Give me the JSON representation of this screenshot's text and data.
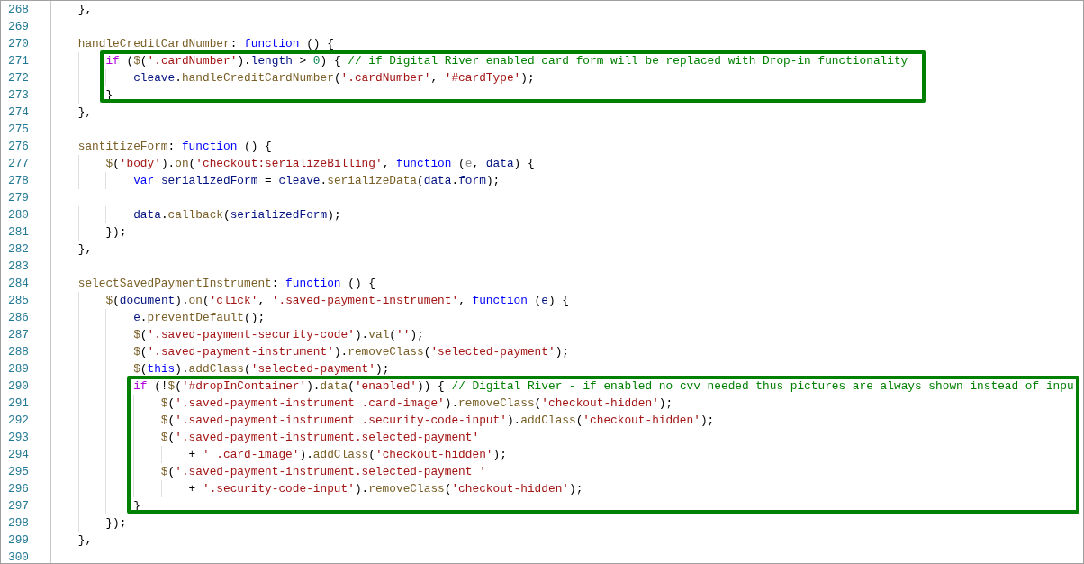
{
  "code": [
    {
      "kind": "line",
      "number": "268",
      "tokens": [
        {
          "text": "    },",
          "kind": "plain"
        }
      ]
    },
    {
      "kind": "line",
      "number": "269"
    },
    {
      "kind": "line",
      "number": "270",
      "tokens": [
        {
          "text": "    handleCreditCardNumber",
          "kind": "function"
        },
        {
          "text": ": ",
          "kind": "plain"
        },
        {
          "text": "function",
          "kind": "keyword"
        },
        {
          "text": " () {",
          "kind": "plain"
        }
      ]
    },
    {
      "kind": "highlight",
      "lines": [
        {
          "kind": "line",
          "number": "271",
          "tokens": [
            {
              "text": "        if",
              "kind": "control"
            },
            {
              "text": " (",
              "kind": "plain"
            },
            {
              "text": "$",
              "kind": "function"
            },
            {
              "text": "(",
              "kind": "plain"
            },
            {
              "text": "'.cardNumber'",
              "kind": "string"
            },
            {
              "text": ").",
              "kind": "plain"
            },
            {
              "text": "length",
              "kind": "variable"
            },
            {
              "text": " > ",
              "kind": "plain"
            },
            {
              "text": "0",
              "kind": "number"
            },
            {
              "text": ") { ",
              "kind": "plain"
            },
            {
              "text": "// if Digital River enabled card form will be replaced with Drop-in functionality",
              "kind": "comment"
            }
          ]
        },
        {
          "kind": "line",
          "number": "272",
          "tokens": [
            {
              "text": "            cleave",
              "kind": "variable"
            },
            {
              "text": ".",
              "kind": "plain"
            },
            {
              "text": "handleCreditCardNumber",
              "kind": "function"
            },
            {
              "text": "(",
              "kind": "plain"
            },
            {
              "text": "'.cardNumber'",
              "kind": "string"
            },
            {
              "text": ", ",
              "kind": "plain"
            },
            {
              "text": "'#cardType'",
              "kind": "string"
            },
            {
              "text": ");",
              "kind": "plain"
            }
          ]
        },
        {
          "kind": "line",
          "number": "273",
          "tokens": [
            {
              "text": "        }",
              "kind": "plain"
            }
          ]
        }
      ]
    },
    {
      "kind": "line",
      "number": "274",
      "tokens": [
        {
          "text": "    },",
          "kind": "plain"
        }
      ]
    },
    {
      "kind": "line",
      "number": "275"
    },
    {
      "kind": "line",
      "number": "276",
      "tokens": [
        {
          "text": "    santitizeForm",
          "kind": "function"
        },
        {
          "text": ": ",
          "kind": "plain"
        },
        {
          "text": "function",
          "kind": "keyword"
        },
        {
          "text": " () {",
          "kind": "plain"
        }
      ]
    },
    {
      "kind": "line",
      "number": "277",
      "tokens": [
        {
          "text": "        $",
          "kind": "function"
        },
        {
          "text": "(",
          "kind": "plain"
        },
        {
          "text": "'body'",
          "kind": "string"
        },
        {
          "text": ").",
          "kind": "plain"
        },
        {
          "text": "on",
          "kind": "function"
        },
        {
          "text": "(",
          "kind": "plain"
        },
        {
          "text": "'checkout:serializeBilling'",
          "kind": "string"
        },
        {
          "text": ", ",
          "kind": "plain"
        },
        {
          "text": "function",
          "kind": "keyword"
        },
        {
          "text": " (",
          "kind": "plain"
        },
        {
          "text": "e",
          "kind": "unused"
        },
        {
          "text": ", ",
          "kind": "plain"
        },
        {
          "text": "data",
          "kind": "variable"
        },
        {
          "text": ") {",
          "kind": "plain"
        }
      ]
    },
    {
      "kind": "line",
      "number": "278",
      "tokens": [
        {
          "text": "            var",
          "kind": "keyword"
        },
        {
          "text": " serializedForm",
          "kind": "variable"
        },
        {
          "text": " = ",
          "kind": "plain"
        },
        {
          "text": "cleave",
          "kind": "variable"
        },
        {
          "text": ".",
          "kind": "plain"
        },
        {
          "text": "serializeData",
          "kind": "function"
        },
        {
          "text": "(",
          "kind": "plain"
        },
        {
          "text": "data",
          "kind": "variable"
        },
        {
          "text": ".",
          "kind": "plain"
        },
        {
          "text": "form",
          "kind": "variable"
        },
        {
          "text": ");",
          "kind": "plain"
        }
      ]
    },
    {
      "kind": "line",
      "number": "279"
    },
    {
      "kind": "line",
      "number": "280",
      "tokens": [
        {
          "text": "            data",
          "kind": "variable"
        },
        {
          "text": ".",
          "kind": "plain"
        },
        {
          "text": "callback",
          "kind": "function"
        },
        {
          "text": "(",
          "kind": "plain"
        },
        {
          "text": "serializedForm",
          "kind": "variable"
        },
        {
          "text": ");",
          "kind": "plain"
        }
      ]
    },
    {
      "kind": "line",
      "number": "281",
      "tokens": [
        {
          "text": "        });",
          "kind": "plain"
        }
      ]
    },
    {
      "kind": "line",
      "number": "282",
      "tokens": [
        {
          "text": "    },",
          "kind": "plain"
        }
      ]
    },
    {
      "kind": "line",
      "number": "283"
    },
    {
      "kind": "line",
      "number": "284",
      "tokens": [
        {
          "text": "    selectSavedPaymentInstrument",
          "kind": "function"
        },
        {
          "text": ": ",
          "kind": "plain"
        },
        {
          "text": "function",
          "kind": "keyword"
        },
        {
          "text": " () {",
          "kind": "plain"
        }
      ]
    },
    {
      "kind": "line",
      "number": "285",
      "tokens": [
        {
          "text": "        $",
          "kind": "function"
        },
        {
          "text": "(",
          "kind": "plain"
        },
        {
          "text": "document",
          "kind": "variable"
        },
        {
          "text": ").",
          "kind": "plain"
        },
        {
          "text": "on",
          "kind": "function"
        },
        {
          "text": "(",
          "kind": "plain"
        },
        {
          "text": "'click'",
          "kind": "string"
        },
        {
          "text": ", ",
          "kind": "plain"
        },
        {
          "text": "'.saved-payment-instrument'",
          "kind": "string"
        },
        {
          "text": ", ",
          "kind": "plain"
        },
        {
          "text": "function",
          "kind": "keyword"
        },
        {
          "text": " (",
          "kind": "plain"
        },
        {
          "text": "e",
          "kind": "variable"
        },
        {
          "text": ") {",
          "kind": "plain"
        }
      ]
    },
    {
      "kind": "line",
      "number": "286",
      "tokens": [
        {
          "text": "            e",
          "kind": "variable"
        },
        {
          "text": ".",
          "kind": "plain"
        },
        {
          "text": "preventDefault",
          "kind": "function"
        },
        {
          "text": "();",
          "kind": "plain"
        }
      ]
    },
    {
      "kind": "line",
      "number": "287",
      "tokens": [
        {
          "text": "            $",
          "kind": "function"
        },
        {
          "text": "(",
          "kind": "plain"
        },
        {
          "text": "'.saved-payment-security-code'",
          "kind": "string"
        },
        {
          "text": ").",
          "kind": "plain"
        },
        {
          "text": "val",
          "kind": "function"
        },
        {
          "text": "(",
          "kind": "plain"
        },
        {
          "text": "''",
          "kind": "string"
        },
        {
          "text": ");",
          "kind": "plain"
        }
      ]
    },
    {
      "kind": "line",
      "number": "288",
      "tokens": [
        {
          "text": "            $",
          "kind": "function"
        },
        {
          "text": "(",
          "kind": "plain"
        },
        {
          "text": "'.saved-payment-instrument'",
          "kind": "string"
        },
        {
          "text": ").",
          "kind": "plain"
        },
        {
          "text": "removeClass",
          "kind": "function"
        },
        {
          "text": "(",
          "kind": "plain"
        },
        {
          "text": "'selected-payment'",
          "kind": "string"
        },
        {
          "text": ");",
          "kind": "plain"
        }
      ]
    },
    {
      "kind": "line",
      "number": "289",
      "tokens": [
        {
          "text": "            $",
          "kind": "function"
        },
        {
          "text": "(",
          "kind": "plain"
        },
        {
          "text": "this",
          "kind": "keyword"
        },
        {
          "text": ").",
          "kind": "plain"
        },
        {
          "text": "addClass",
          "kind": "function"
        },
        {
          "text": "(",
          "kind": "plain"
        },
        {
          "text": "'selected-payment'",
          "kind": "string"
        },
        {
          "text": ");",
          "kind": "plain"
        }
      ]
    },
    {
      "kind": "highlight",
      "lines": [
        {
          "kind": "line",
          "number": "290",
          "tokens": [
            {
              "text": "            if",
              "kind": "control"
            },
            {
              "text": " (!",
              "kind": "plain"
            },
            {
              "text": "$",
              "kind": "function"
            },
            {
              "text": "(",
              "kind": "plain"
            },
            {
              "text": "'#dropInContainer'",
              "kind": "string"
            },
            {
              "text": ").",
              "kind": "plain"
            },
            {
              "text": "data",
              "kind": "function"
            },
            {
              "text": "(",
              "kind": "plain"
            },
            {
              "text": "'enabled'",
              "kind": "string"
            },
            {
              "text": ")) { ",
              "kind": "plain"
            },
            {
              "text": "// Digital River - if enabled no cvv needed thus pictures are always shown instead of inpu",
              "kind": "comment"
            }
          ]
        },
        {
          "kind": "line",
          "number": "291",
          "tokens": [
            {
              "text": "                $",
              "kind": "function"
            },
            {
              "text": "(",
              "kind": "plain"
            },
            {
              "text": "'.saved-payment-instrument .card-image'",
              "kind": "string"
            },
            {
              "text": ").",
              "kind": "plain"
            },
            {
              "text": "removeClass",
              "kind": "function"
            },
            {
              "text": "(",
              "kind": "plain"
            },
            {
              "text": "'checkout-hidden'",
              "kind": "string"
            },
            {
              "text": ");",
              "kind": "plain"
            }
          ]
        },
        {
          "kind": "line",
          "number": "292",
          "tokens": [
            {
              "text": "                $",
              "kind": "function"
            },
            {
              "text": "(",
              "kind": "plain"
            },
            {
              "text": "'.saved-payment-instrument .security-code-input'",
              "kind": "string"
            },
            {
              "text": ").",
              "kind": "plain"
            },
            {
              "text": "addClass",
              "kind": "function"
            },
            {
              "text": "(",
              "kind": "plain"
            },
            {
              "text": "'checkout-hidden'",
              "kind": "string"
            },
            {
              "text": ");",
              "kind": "plain"
            }
          ]
        },
        {
          "kind": "line",
          "number": "293",
          "tokens": [
            {
              "text": "                $",
              "kind": "function"
            },
            {
              "text": "(",
              "kind": "plain"
            },
            {
              "text": "'.saved-payment-instrument.selected-payment'",
              "kind": "string"
            }
          ]
        },
        {
          "kind": "line",
          "number": "294",
          "tokens": [
            {
              "text": "                    + ",
              "kind": "plain"
            },
            {
              "text": "' .card-image'",
              "kind": "string"
            },
            {
              "text": ").",
              "kind": "plain"
            },
            {
              "text": "addClass",
              "kind": "function"
            },
            {
              "text": "(",
              "kind": "plain"
            },
            {
              "text": "'checkout-hidden'",
              "kind": "string"
            },
            {
              "text": ");",
              "kind": "plain"
            }
          ]
        },
        {
          "kind": "line",
          "number": "295",
          "tokens": [
            {
              "text": "                $",
              "kind": "function"
            },
            {
              "text": "(",
              "kind": "plain"
            },
            {
              "text": "'.saved-payment-instrument.selected-payment '",
              "kind": "string"
            }
          ]
        },
        {
          "kind": "line",
          "number": "296",
          "tokens": [
            {
              "text": "                    + ",
              "kind": "plain"
            },
            {
              "text": "'.security-code-input'",
              "kind": "string"
            },
            {
              "text": ").",
              "kind": "plain"
            },
            {
              "text": "removeClass",
              "kind": "function"
            },
            {
              "text": "(",
              "kind": "plain"
            },
            {
              "text": "'checkout-hidden'",
              "kind": "string"
            },
            {
              "text": ");",
              "kind": "plain"
            }
          ]
        },
        {
          "kind": "line",
          "number": "297",
          "tokens": [
            {
              "text": "            }",
              "kind": "plain"
            }
          ]
        }
      ]
    },
    {
      "kind": "line",
      "number": "298",
      "tokens": [
        {
          "text": "        });",
          "kind": "plain"
        }
      ]
    },
    {
      "kind": "line",
      "number": "299",
      "tokens": [
        {
          "text": "    },",
          "kind": "plain"
        }
      ]
    },
    {
      "kind": "line",
      "number": "300"
    }
  ]
}
